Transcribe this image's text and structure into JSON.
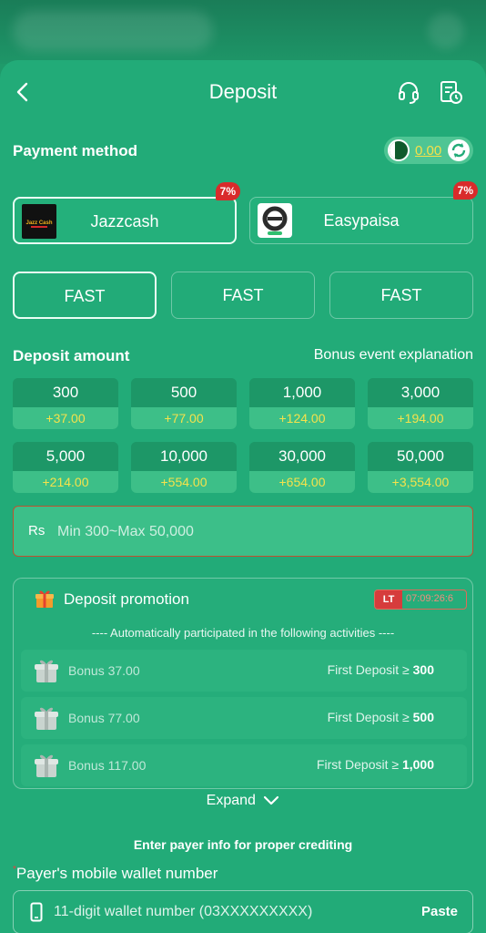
{
  "header": {
    "title": "Deposit"
  },
  "payment": {
    "label": "Payment method",
    "balance": "0.00",
    "methods": [
      {
        "name": "Jazzcash",
        "badge": "7%",
        "logo_text": "Jazz Cash"
      },
      {
        "name": "Easypaisa",
        "badge": "7%"
      }
    ],
    "channels": [
      "FAST",
      "FAST",
      "FAST"
    ]
  },
  "deposit": {
    "label": "Deposit amount",
    "bonus_link": "Bonus event explanation",
    "amounts": [
      {
        "value": "300",
        "bonus": "+37.00"
      },
      {
        "value": "500",
        "bonus": "+77.00"
      },
      {
        "value": "1,000",
        "bonus": "+124.00"
      },
      {
        "value": "3,000",
        "bonus": "+194.00"
      },
      {
        "value": "5,000",
        "bonus": "+214.00"
      },
      {
        "value": "10,000",
        "bonus": "+554.00"
      },
      {
        "value": "30,000",
        "bonus": "+654.00"
      },
      {
        "value": "50,000",
        "bonus": "+3,554.00"
      }
    ],
    "currency": "Rs",
    "placeholder": "Min 300~Max 50,000"
  },
  "promotion": {
    "title": "Deposit promotion",
    "tag": "LT",
    "timer": "07:09:26:6",
    "auto_text": "---- Automatically participated in the following activities ----",
    "items": [
      {
        "bonus": "Bonus 37.00",
        "cond": "First Deposit ≥ ",
        "cond_val": "300"
      },
      {
        "bonus": "Bonus 77.00",
        "cond": "First Deposit ≥ ",
        "cond_val": "500"
      },
      {
        "bonus": "Bonus 117.00",
        "cond": "First Deposit ≥ ",
        "cond_val": "1,000"
      }
    ],
    "expand": "Expand"
  },
  "payer": {
    "info": "Enter payer info for proper crediting",
    "wallet_label": "Payer's mobile wallet number",
    "wallet_placeholder": "11-digit wallet number (03XXXXXXXXX)",
    "paste": "Paste"
  }
}
